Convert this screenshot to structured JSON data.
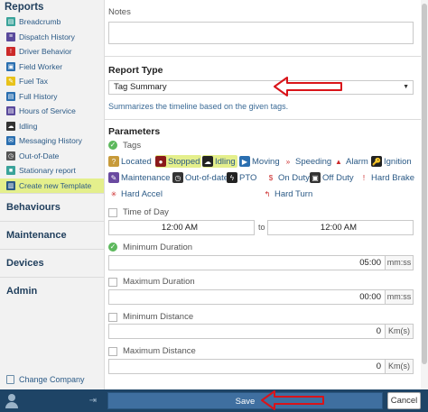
{
  "sidebar": {
    "reports_heading": "Reports",
    "report_items": [
      {
        "label": "Breadcrumb",
        "icon": "breadcrumb-icon",
        "color": "#3aa39a",
        "glyph": "▤"
      },
      {
        "label": "Dispatch History",
        "icon": "dispatch-icon",
        "color": "#5a4a9c",
        "glyph": "≡"
      },
      {
        "label": "Driver Behavior",
        "icon": "alert-icon",
        "color": "#cc2a2a",
        "glyph": "!"
      },
      {
        "label": "Field Worker",
        "icon": "worker-icon",
        "color": "#2b6fb0",
        "glyph": "▣"
      },
      {
        "label": "Fuel Tax",
        "icon": "fuel-icon",
        "color": "#e8c21a",
        "glyph": "✎"
      },
      {
        "label": "Full History",
        "icon": "history-icon",
        "color": "#2b6fb0",
        "glyph": "▤"
      },
      {
        "label": "Hours of Service",
        "icon": "hos-icon",
        "color": "#5a4a9c",
        "glyph": "▤"
      },
      {
        "label": "Idling",
        "icon": "idle-icon",
        "color": "#333333",
        "glyph": "☁"
      },
      {
        "label": "Messaging History",
        "icon": "message-icon",
        "color": "#2b6fb0",
        "glyph": "✉"
      },
      {
        "label": "Out-of-Date",
        "icon": "clock-icon",
        "color": "#555555",
        "glyph": "◷"
      },
      {
        "label": "Stationary report",
        "icon": "stationary-icon",
        "color": "#3aa39a",
        "glyph": "■"
      },
      {
        "label": "Create new Template",
        "icon": "chart-icon",
        "color": "#2b5a86",
        "glyph": "▥"
      }
    ],
    "sections": [
      "Behaviours",
      "Maintenance",
      "Devices",
      "Admin"
    ],
    "change_company": "Change Company"
  },
  "form": {
    "notes_label": "Notes",
    "report_type_title": "Report Type",
    "report_type_value": "Tag Summary",
    "report_type_desc": "Summarizes the timeline based on the given tags.",
    "parameters_title": "Parameters",
    "tags_label": "Tags",
    "tags": [
      {
        "label": "Located",
        "icon": "located-icon",
        "color": "#c79a3a",
        "glyph": "?",
        "selected": false
      },
      {
        "label": "Stopped",
        "icon": "stopped-icon",
        "color": "#8a1a1a",
        "glyph": "●",
        "selected": true
      },
      {
        "label": "Idling",
        "icon": "idling-icon",
        "color": "#222222",
        "glyph": "☁",
        "selected": true
      },
      {
        "label": "Moving",
        "icon": "moving-icon",
        "color": "#2b6fb0",
        "glyph": "▶",
        "selected": false
      },
      {
        "label": "Speeding",
        "icon": "speeding-icon",
        "color": "#ffffff",
        "glyph": "»",
        "selected": false
      },
      {
        "label": "Alarm",
        "icon": "alarm-icon",
        "color": "#ffffff",
        "glyph": "▲",
        "selected": false
      },
      {
        "label": "Ignition",
        "icon": "ignition-icon",
        "color": "#222222",
        "glyph": "🔑",
        "selected": false
      },
      {
        "label": "Maintenance",
        "icon": "maintenance-icon",
        "color": "#6a4aa0",
        "glyph": "✎",
        "selected": false
      },
      {
        "label": "Out-of-date",
        "icon": "outofdate-icon",
        "color": "#333333",
        "glyph": "◷",
        "selected": false
      },
      {
        "label": "PTO",
        "icon": "pto-icon",
        "color": "#222222",
        "glyph": "ϟ",
        "selected": false
      },
      {
        "label": "On Duty",
        "icon": "onduty-icon",
        "color": "#ffffff",
        "glyph": "$",
        "selected": false
      },
      {
        "label": "Off Duty",
        "icon": "offduty-icon",
        "color": "#333333",
        "glyph": "▣",
        "selected": false
      },
      {
        "label": "Hard Brake",
        "icon": "hardbrake-icon",
        "color": "#ffffff",
        "glyph": "!",
        "selected": false
      },
      {
        "label": "Hard Accel",
        "icon": "hardaccel-icon",
        "color": "#ffffff",
        "glyph": "✳",
        "selected": false
      },
      {
        "label": "Hard Turn",
        "icon": "hardturn-icon",
        "color": "#ffffff",
        "glyph": "↰",
        "selected": false
      }
    ],
    "time_of_day_label": "Time of Day",
    "time_from": "12:00 AM",
    "time_to_word": "to",
    "time_to": "12:00 AM",
    "min_duration_label": "Minimum Duration",
    "min_duration_value": "05:00",
    "min_duration_unit": "mm:ss",
    "max_duration_label": "Maximum Duration",
    "max_duration_value": "00:00",
    "max_duration_unit": "mm:ss",
    "min_distance_label": "Minimum Distance",
    "min_distance_value": "0",
    "min_distance_unit": "Km(s)",
    "max_distance_label": "Maximum Distance",
    "max_distance_value": "0",
    "max_distance_unit": "Km(s)"
  },
  "footer": {
    "save_label": "Save",
    "cancel_label": "Cancel"
  },
  "colors": {
    "accent": "#1e4466",
    "highlight": "#e4ef8c",
    "annotation_arrow": "#d9141a"
  }
}
